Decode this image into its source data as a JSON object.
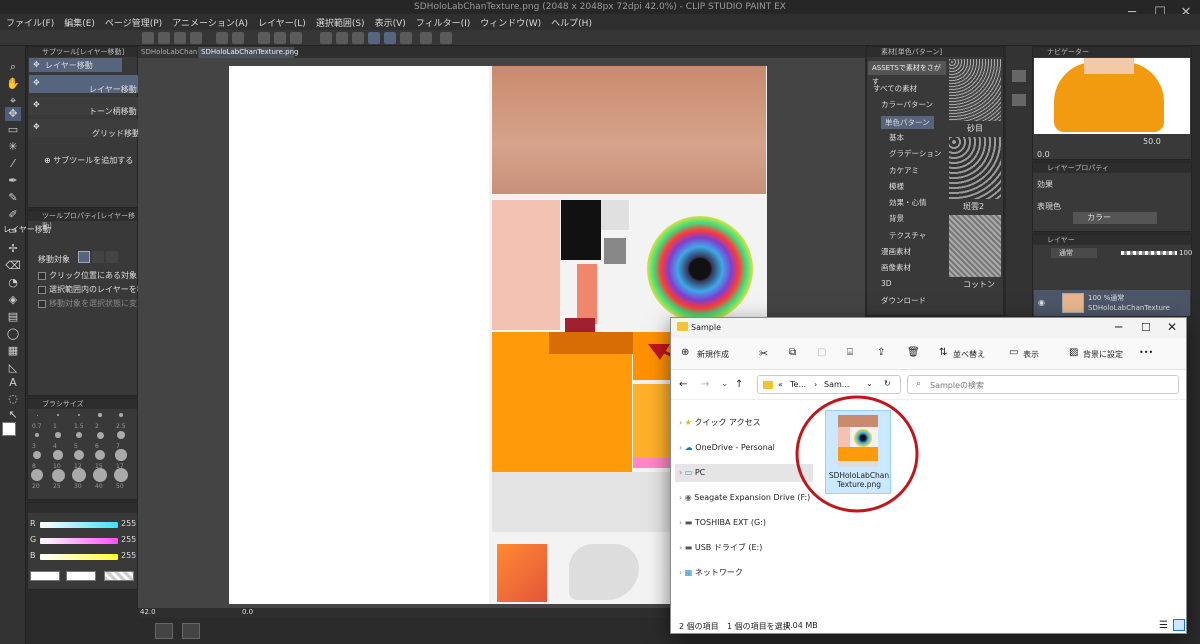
{
  "window": {
    "title": "SDHoloLabChanTexture.png (2048 x 2048px 72dpi 42.0%) - CLIP STUDIO PAINT EX",
    "controls": [
      "─",
      "☐",
      "✕"
    ]
  },
  "menu": [
    "ファイル(F)",
    "編集(E)",
    "ページ管理(P)",
    "アニメーション(A)",
    "レイヤー(L)",
    "選択範囲(S)",
    "表示(V)",
    "フィルター(I)",
    "ウィンドウ(W)",
    "ヘルプ(H)"
  ],
  "doc_tabs": [
    "SDHoloLabChan",
    "SDHoloLabChanTexture.png"
  ],
  "subtool_panel": {
    "header": "サブツール[レイヤー移動]",
    "group": "レイヤー移動",
    "items": [
      "レイヤー移動",
      "トーン柄移動",
      "グリッド移動"
    ],
    "add_label": "サブツールを追加する"
  },
  "tool_property": {
    "header": "ツールプロパティ[レイヤー移動]",
    "title": "レイヤー移動",
    "target_label": "移動対象",
    "options": [
      "クリック位置にある対象を移動",
      "選択範囲内のレイヤーを移動",
      "移動対象を選択状態に変更"
    ]
  },
  "brush_size": {
    "header": "ブラシサイズ",
    "sizes": [
      "0.7",
      "1",
      "1.5",
      "2",
      "2.5",
      "3",
      "4",
      "5",
      "6",
      "7",
      "8",
      "10",
      "12",
      "15",
      "17",
      "20",
      "25",
      "30",
      "40",
      "50"
    ]
  },
  "color_sliders": [
    {
      "label": "R",
      "value": "255",
      "color": "#3ee0ff"
    },
    {
      "label": "G",
      "value": "255",
      "color": "#ff4dff"
    },
    {
      "label": "B",
      "value": "255",
      "color": "#ffff33"
    }
  ],
  "status": {
    "zoom": "42.0",
    "angle": "0.0"
  },
  "material_panel": {
    "header": "素材[単色パターン]",
    "assets_btn": "ASSETSで素材をさがす",
    "tree": [
      "すべての素材",
      "カラーパターン",
      "単色パターン",
      "基本",
      "グラデーション",
      "カケアミ",
      "模様",
      "効果・心情",
      "背景",
      "テクスチャ",
      "漫画素材",
      "画像素材",
      "3D",
      "ダウンロード"
    ],
    "thumbs": [
      "砂目",
      "斑雲2",
      "コットン"
    ]
  },
  "navigator": {
    "header": "ナビゲーター",
    "zoom": "50.0",
    "angle": "0.0"
  },
  "layer_property": {
    "header": "レイヤープロパティ",
    "effect_label": "効果",
    "expression_label": "表現色",
    "expression_value": "カラー"
  },
  "layer_panel": {
    "header": "レイヤー",
    "blend": "通常",
    "opacity": "100",
    "layer_meta": "100 %通常",
    "layer_name": "SDHoloLabChanTexture"
  },
  "explorer": {
    "title": "Sample",
    "toolbar": {
      "new": "新規作成",
      "sort": "並べ替え",
      "view": "表示",
      "background": "背景に設定",
      "more": "•••"
    },
    "path": [
      "«",
      "Te...",
      "›",
      "Sam..."
    ],
    "search_placeholder": "Sampleの検索",
    "nav": [
      "クイック アクセス",
      "OneDrive - Personal",
      "PC",
      "Seagate Expansion Drive (F:)",
      "TOSHIBA EXT (G:)",
      "USB ドライブ (E:)",
      "ネットワーク"
    ],
    "file_name": "SDHoloLabChanTexture.png",
    "status": {
      "items": "2 個の項目",
      "selected": "1 個の項目を選択",
      "size": "1.04 MB"
    }
  },
  "accent_colors": {
    "selection": "#56647e",
    "annotation": "#c0161b",
    "explorer_selected": "#cce8ff"
  }
}
